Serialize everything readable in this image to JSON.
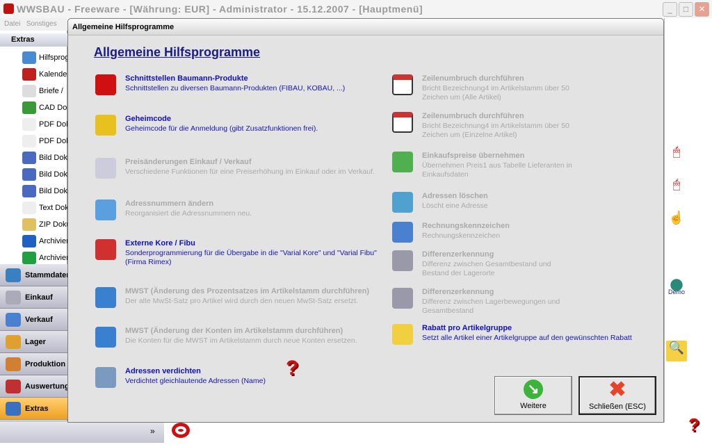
{
  "window": {
    "title": "WWSBAU - Freeware - [Währung: EUR] - Administrator - 15.12.2007 - [Hauptmenü]",
    "minimize": "_",
    "maximize": "□",
    "close": "✕"
  },
  "menu": [
    "Datei",
    "Sonstiges"
  ],
  "leftpanel": {
    "header": "Extras",
    "tree": [
      "Hilfsprogramme",
      "Kalender",
      "Briefe / ",
      "CAD Dokumente",
      "PDF Dokumente",
      "PDF Dokumente",
      "Bild Dokumente",
      "Bild Dokumente",
      "Bild Dokumente",
      "Text Dokumente",
      "ZIP Dokumente",
      "Archivieren",
      "Archivieren"
    ],
    "nav": [
      "Stammdaten",
      "Einkauf",
      "Verkauf",
      "Lager",
      "Produktion",
      "Auswertung",
      "Extras"
    ],
    "chevron": "»"
  },
  "dialog": {
    "title": "Allgemeine Hilfsprogramme",
    "heading": "Allgemeine Hilfsprogramme",
    "left_items": [
      {
        "title": "Schnittstellen Baumann-Produkte",
        "desc": "Schnittstellen zu diversen Baumann-Produkten (FIBAU, KOBAU, ...)",
        "enabled": true,
        "icon": "baumann-icon"
      },
      {
        "title": "Geheimcode",
        "desc": "Geheimcode für die Anmeldung (gibt Zusatzfunktionen frei).",
        "enabled": true,
        "icon": "padlock-icon"
      },
      {
        "title": "Preisänderungen Einkauf / Verkauf",
        "desc": "Verschiedene Funktionen für eine Preiserhöhung im Einkauf oder im Verkauf.",
        "enabled": false,
        "icon": "document-icon"
      },
      {
        "title": "Adressnummern ändern",
        "desc": "Reorganisiert die Adressnummern neu.",
        "enabled": false,
        "icon": "refresh-icon"
      },
      {
        "title": "Externe Kore / Fibu",
        "desc": "Sonderprogrammierung für die Übergabe in die \"Varial Kore\" und \"Varial Fibu\" (Firma Rimex)",
        "enabled": true,
        "icon": "cycle-icon"
      },
      {
        "title": "MWST (Änderung des Prozentsatzes im Artikelstamm durchführen)",
        "desc": "Der alte MwSt-Satz pro Artikel wird durch den neuen MwSt-Satz ersetzt.",
        "enabled": false,
        "icon": "up-down-arrow-icon"
      },
      {
        "title": "MWST (Änderung der Konten im Artikelstamm durchführen)",
        "desc": "Die Konten für die MWST im Artikelstamm durch neue Konten ersetzen.",
        "enabled": false,
        "icon": "up-down-arrow-icon"
      },
      {
        "title": "Adressen verdichten",
        "desc": "Verdichtet gleichlautende Adressen (Name)",
        "enabled": true,
        "icon": "database-icon"
      }
    ],
    "right_items": [
      {
        "title": "Zeilenumbruch durchführen",
        "desc": "Bricht Bezeichnung4 im Artikelstamm über 50 Zeichen um (Alle Artikel)",
        "enabled": false,
        "icon": "zeilen-icon"
      },
      {
        "title": "Zeilenumbruch durchführen",
        "desc": "Bricht Bezeichnung4 im Artikelstamm über 50 Zeichen um (Einzelne Artikel)",
        "enabled": false,
        "icon": "zeilen-icon"
      },
      {
        "title": "Einkaufspreise übernehmen",
        "desc": "Übernehmen Preis1 aus Tabelle Lieferanten in Einkaufsdaten",
        "enabled": false,
        "icon": "download-icon"
      },
      {
        "title": "Adressen löschen",
        "desc": "Löscht eine Adresse",
        "enabled": false,
        "icon": "recycle-bin-icon"
      },
      {
        "title": "Rechnungskennzeichen",
        "desc": "Rechnungskennzeichen",
        "enabled": false,
        "icon": "checklist-icon"
      },
      {
        "title": "Differenzerkennung",
        "desc": "Differenz zwischen Gesamtbestand und Bestand der Lagerorte",
        "enabled": false,
        "icon": "binoculars-icon"
      },
      {
        "title": "Differenzerkennung",
        "desc": "Differenz zwischen Lagerbewegungen und Gesamtbestand",
        "enabled": false,
        "icon": "binoculars-icon"
      },
      {
        "title": "Rabatt pro Artikelgruppe",
        "desc": "Setzt alle Artikel einer Artikelgruppe auf den gewünschten Rabatt",
        "enabled": true,
        "icon": "star-add-icon"
      }
    ],
    "help": "?",
    "buttons": {
      "more": "Weitere",
      "close": "Schließen (ESC)"
    }
  },
  "right_strip": {
    "demo": "Demo",
    "help": "?"
  }
}
